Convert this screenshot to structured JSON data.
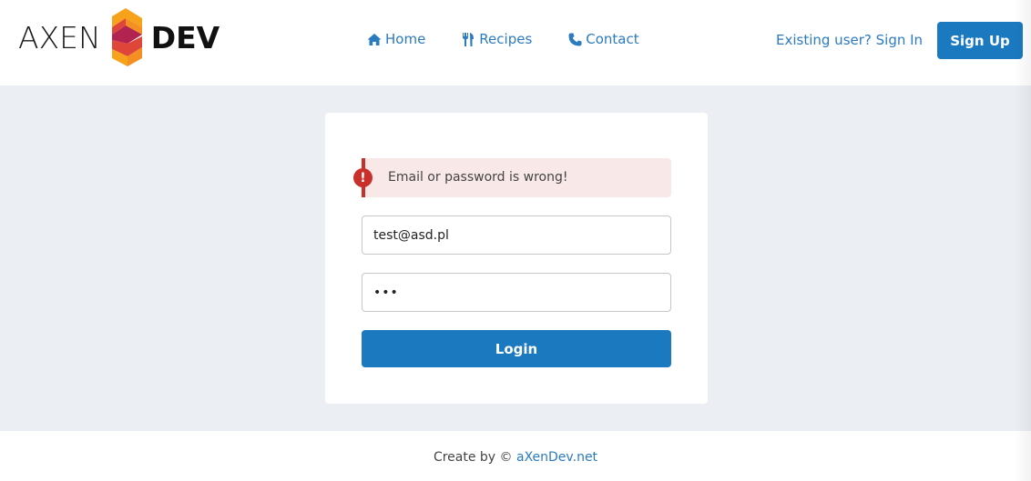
{
  "brand": {
    "left_text": "AXEN",
    "right_text": "DEV",
    "colors": {
      "orange": "#f7a21b",
      "red": "#e0453a",
      "crimson": "#b3234f"
    }
  },
  "nav": {
    "items": [
      {
        "label": "Home",
        "icon": "home-icon"
      },
      {
        "label": "Recipes",
        "icon": "utensils-icon"
      },
      {
        "label": "Contact",
        "icon": "phone-icon"
      }
    ],
    "signin_label": "Existing user? Sign In",
    "signup_label": "Sign Up"
  },
  "login": {
    "alert": {
      "icon": "exclamation-icon",
      "text": "Email or password is wrong!"
    },
    "email_value": "test@asd.pl",
    "password_value": "•••",
    "button_label": "Login"
  },
  "footer": {
    "prefix": "Create by ©",
    "link_label": "aXenDev.net"
  },
  "colors": {
    "primary": "#1b79c0",
    "link": "#2b7bbf",
    "page_bg": "#ebeef3",
    "alert_bg": "#f8e8e8",
    "alert_accent": "#c9302c"
  }
}
